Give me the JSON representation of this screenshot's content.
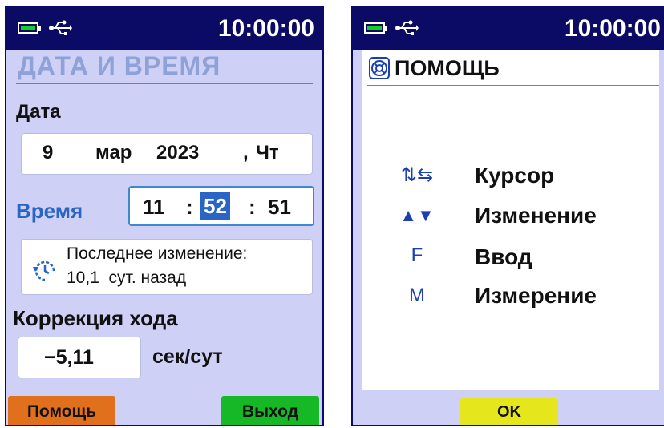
{
  "left_screen": {
    "status": {
      "time": "10:00:00",
      "battery_icon": "battery-icon",
      "usb_icon": "usb-icon"
    },
    "title": "ДАТА И ВРЕМЯ",
    "date_label": "Дата",
    "date": {
      "day": "9",
      "month": "мар",
      "year": "2023",
      "sep": ",",
      "weekday": "Чт"
    },
    "time_label": "Время",
    "time": {
      "hours": "11",
      "sep1": ":",
      "minutes": "52",
      "sep2": ":",
      "seconds": "51"
    },
    "last_change": {
      "line1": "Последнее изменение:",
      "line2": "10,1  сут. назад",
      "icon": "history-icon"
    },
    "correction_label": "Коррекция хода",
    "correction_value": "−5,11",
    "correction_unit": "сек/сут",
    "help_button": "Помощь",
    "exit_button": "Выход"
  },
  "right_screen": {
    "status": {
      "time": "10:00:00"
    },
    "title": "ПОМОЩЬ",
    "title_icon": "lifebuoy-icon",
    "rows": [
      {
        "key": "⇅⇆",
        "icon": "cursor-arrows-icon",
        "text": "Курсор"
      },
      {
        "key": "▲▼",
        "icon": "up-down-triangles-icon",
        "text": "Изменение"
      },
      {
        "key": "F",
        "icon": "f-key-icon",
        "text": "Ввод"
      },
      {
        "key": "M",
        "icon": "m-key-icon",
        "text": "Измерение"
      }
    ],
    "ok_button": "OK"
  },
  "colors": {
    "status_bar": "#0b0b66",
    "screen_bg": "#cfd0f5",
    "title_light": "#8fa2d8",
    "accent_blue": "#2a64c4",
    "help_button": "#e0701c",
    "exit_button": "#16b825",
    "ok_button": "#e6e61c"
  }
}
